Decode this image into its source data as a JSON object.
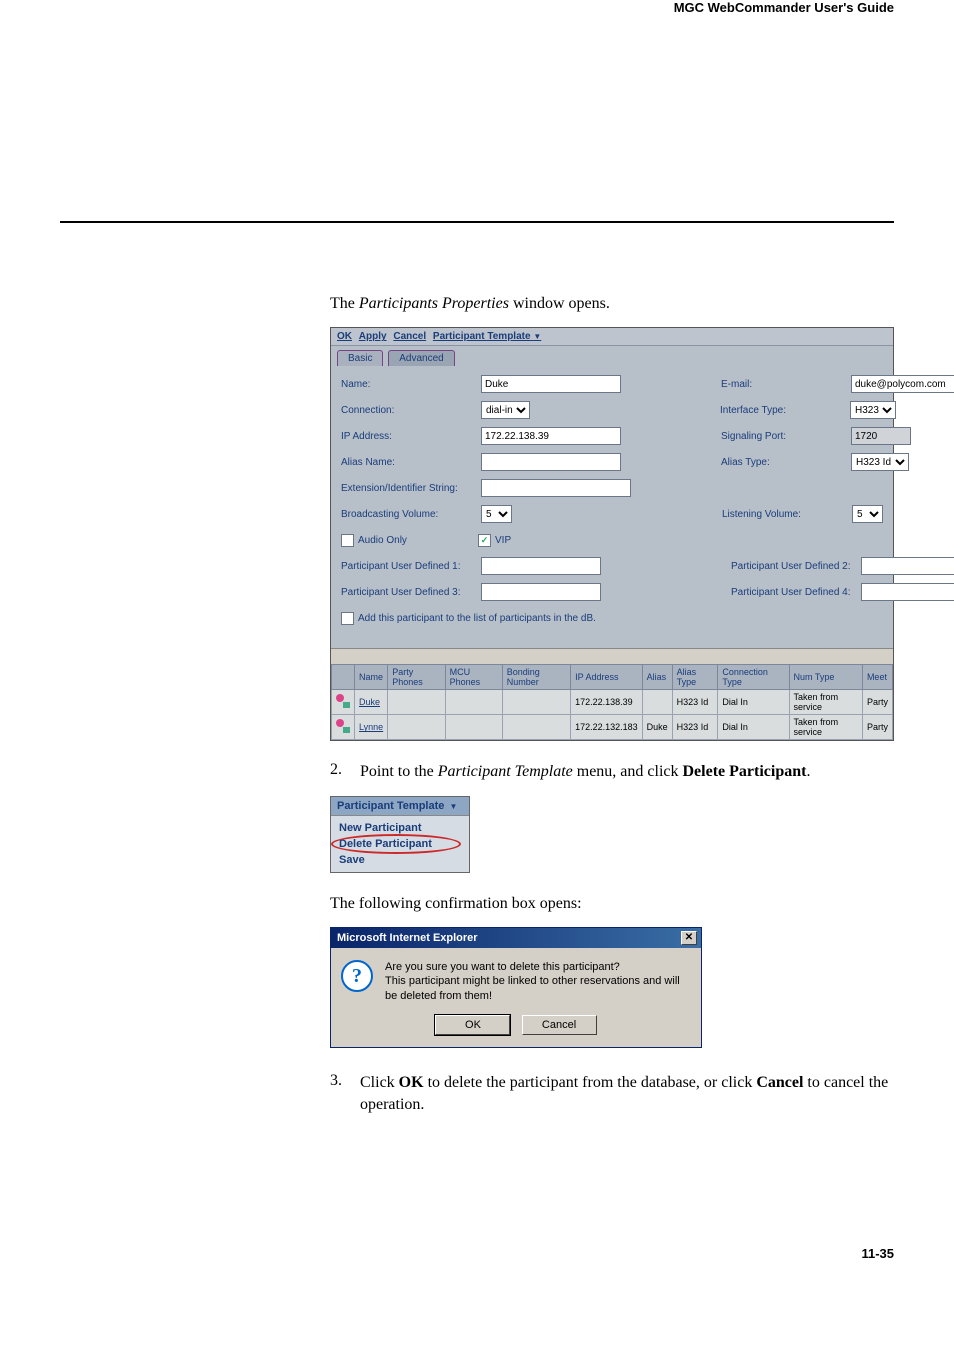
{
  "page_header": "MGC WebCommander User's Guide",
  "page_number": "11-35",
  "opening_line": {
    "prefix": "The ",
    "italic": "Participants Properties",
    "suffix": " window opens."
  },
  "window": {
    "toolbar": {
      "ok": "OK",
      "apply": "Apply",
      "cancel": "Cancel",
      "menu": "Participant Template",
      "arrow": "▼"
    },
    "tabs": {
      "basic": "Basic",
      "advanced": "Advanced"
    },
    "form": {
      "name_label": "Name:",
      "name_value": "Duke",
      "email_label": "E-mail:",
      "email_value": "duke@polycom.com",
      "connection_label": "Connection:",
      "connection_value": "dial-in",
      "interface_label": "Interface Type:",
      "interface_value": "H323",
      "ip_label": "IP Address:",
      "ip_value": "172.22.138.39",
      "signaling_label": "Signaling Port:",
      "signaling_value": "1720",
      "alias_name_label": "Alias Name:",
      "alias_name_value": "",
      "alias_type_label": "Alias Type:",
      "alias_type_value": "H323 Id",
      "ext_label": "Extension/Identifier String:",
      "ext_value": "",
      "broadcast_label": "Broadcasting Volume:",
      "broadcast_value": "5",
      "listening_label": "Listening Volume:",
      "listening_value": "5",
      "audio_only_label": "Audio Only",
      "vip_label": "VIP",
      "pu1_label": "Participant User Defined 1:",
      "pu2_label": "Participant User Defined 2:",
      "pu3_label": "Participant User Defined 3:",
      "pu4_label": "Participant User Defined 4:",
      "add_to_db_label": "Add this participant to the list of participants in the dB."
    },
    "grid": {
      "headers": {
        "blank": "",
        "name": "Name",
        "party_phones": "Party Phones",
        "mcu_phones": "MCU Phones",
        "bonding": "Bonding Number",
        "ip": "IP Address",
        "alias": "Alias",
        "alias_type": "Alias Type",
        "conn_type": "Connection Type",
        "num_type": "Num Type",
        "meet": "Meet"
      },
      "rows": [
        {
          "name": "Duke",
          "party_phones": "",
          "mcu_phones": "",
          "bonding": "",
          "ip": "172.22.138.39",
          "alias": "",
          "alias_type": "H323 Id",
          "conn_type": "Dial In",
          "num_type": "Taken from service",
          "meet": "Party"
        },
        {
          "name": "Lynne",
          "party_phones": "",
          "mcu_phones": "",
          "bonding": "",
          "ip": "172.22.132.183",
          "alias": "Duke",
          "alias_type": "H323 Id",
          "conn_type": "Dial In",
          "num_type": "Taken from service",
          "meet": "Party"
        }
      ]
    }
  },
  "step2": {
    "num": "2.",
    "prefix": "Point to the ",
    "italic": "Participant Template",
    "mid": " menu, and click ",
    "bold": "Delete Participant",
    "suffix": "."
  },
  "menu_snippet": {
    "header": "Participant Template",
    "arrow": "▼",
    "new": "New Participant",
    "delete": "Delete Participant",
    "save": "Save"
  },
  "confirm_line": "The following confirmation box opens:",
  "dialog": {
    "title": "Microsoft Internet Explorer",
    "icon": "?",
    "line1": "Are you sure you want to delete this participant?",
    "line2": "This participant might be linked to other reservations and will be deleted from them!",
    "ok": "OK",
    "cancel": "Cancel"
  },
  "step3": {
    "num": "3.",
    "prefix": "Click ",
    "bold1": "OK",
    "mid": " to delete the participant from the database, or click ",
    "bold2": "Cancel",
    "suffix": " to cancel the operation."
  }
}
